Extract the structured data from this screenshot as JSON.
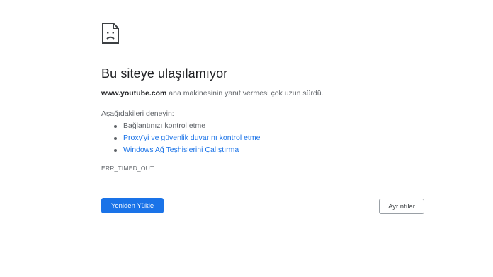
{
  "icon": "sad-page-icon",
  "title": "Bu siteye ulaşılamıyor",
  "message": {
    "host": "www.youtube.com",
    "text": " ana makinesinin yanıt vermesi çok uzun sürdü."
  },
  "try_label": "Aşağıdakileri deneyin:",
  "suggestions": [
    "Bağlantınızı kontrol etme",
    "Proxy'yi ve güvenlik duvarını kontrol etme",
    "Windows Ağ Teşhislerini Çalıştırma"
  ],
  "error_code": "ERR_TIMED_OUT",
  "buttons": {
    "reload": "Yeniden Yükle",
    "details": "Ayrıntılar"
  },
  "colors": {
    "accent": "#1a73e8",
    "title": "#202124",
    "text": "#5f6368"
  }
}
